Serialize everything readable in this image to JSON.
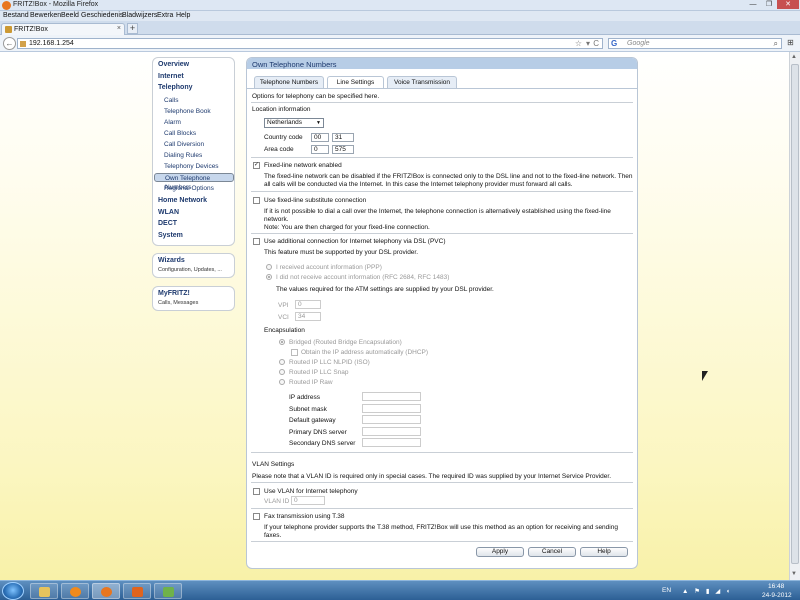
{
  "window": {
    "title": "FRITZ!Box - Mozilla Firefox",
    "min_glyph": "—",
    "max_glyph": "❐",
    "close_glyph": "✕"
  },
  "menubar": [
    "Bestand",
    "Bewerken",
    "Beeld",
    "Geschiedenis",
    "Bladwijzers",
    "Extra",
    "Help"
  ],
  "tab": {
    "label": "FRITZ!Box",
    "close_glyph": "×",
    "new_tab_glyph": "+"
  },
  "navbar": {
    "back_glyph": "←",
    "url": "192.168.1.254",
    "star_glyph": "☆",
    "dropdown_glyph": "▾",
    "reload_glyph": "C",
    "search_engine": "G",
    "search_placeholder": "Google",
    "search_glyph": "⌕",
    "menu_glyph": "⊞"
  },
  "sidebar": {
    "overview": "Overview",
    "internet": "Internet",
    "telephony": "Telephony",
    "sub": [
      "Calls",
      "Telephone Book",
      "Alarm",
      "Call Blocks",
      "Call Diversion",
      "Dialing Rules",
      "Telephony Devices",
      "Own Telephone Numbers",
      "Regional Options"
    ],
    "home_network": "Home Network",
    "wlan": "WLAN",
    "dect": "DECT",
    "system": "System",
    "wizards_title": "Wizards",
    "wizards_sub": "Configuration, Updates, ...",
    "myfritz_title": "MyFRITZ!",
    "myfritz_sub": "Calls, Messages"
  },
  "content": {
    "header": "Own Telephone Numbers",
    "tabs": [
      "Telephone Numbers",
      "Line Settings",
      "Voice Transmission"
    ],
    "intro": "Options for telephony can be specified here.",
    "location_title": "Location information",
    "country_select": "Netherlands",
    "country_code_label": "Country code",
    "country_code_prefix": "00",
    "country_code": "31",
    "area_code_label": "Area code",
    "area_code_prefix": "0",
    "area_code": "575",
    "fixed_line_label": "Fixed-line network enabled",
    "fixed_line_desc1": "The fixed-line network can be disabled if the FRITZ!Box is connected only to the DSL line and not to the fixed-line network. Then",
    "fixed_line_desc2": "all calls will be conducted via the Internet. In this case the Internet telephony provider must forward all calls.",
    "substitute_label": "Use fixed-line substitute connection",
    "substitute_desc1": "If it is not possible to dial a call over the Internet, the telephone connection is alternatively established using the fixed-line",
    "substitute_desc2": "network.",
    "substitute_desc3": "Note: You are then charged for your fixed-line connection.",
    "additional_label": "Use additional connection for Internet telephony via DSL (PVC)",
    "additional_desc": "This feature must be supported by your DSL provider.",
    "radio_received": "I received account information (PPP)",
    "radio_not_received": "I did not receive account information (RFC 2684, RFC 1483)",
    "atm_desc": "The values required for the ATM settings are supplied by your DSL provider.",
    "vpi_label": "VPI",
    "vpi": "0",
    "vci_label": "VCI",
    "vci": "34",
    "encap_title": "Encapsulation",
    "encap_bridged": "Bridged (Routed Bridge Encapsulation)",
    "encap_dhcp": "Obtain the IP address automatically (DHCP)",
    "encap_llc_nlpid": "Routed IP LLC NLPID (ISO)",
    "encap_llc_snap": "Routed IP LLC Snap",
    "encap_raw": "Routed IP Raw",
    "ip_address_label": "IP address",
    "subnet_mask_label": "Subnet mask",
    "default_gateway_label": "Default gateway",
    "primary_dns_label": "Primary DNS server",
    "secondary_dns_label": "Secondary DNS server",
    "vlan_title": "VLAN Settings",
    "vlan_desc": "Please note that a VLAN ID is required only in special cases. The required ID was supplied by your Internet Service Provider.",
    "vlan_use_label": "Use VLAN for Internet telephony",
    "vlan_id_label": "VLAN ID",
    "vlan_id": "0",
    "fax_label": "Fax transmission using T.38",
    "fax_desc1": "If your telephone provider supports the T.38 method, FRITZ!Box will use this method as an option for receiving and sending",
    "fax_desc2": "faxes.",
    "check_glyph": "✓",
    "select_caret": "▼",
    "apply": "Apply",
    "cancel": "Cancel",
    "help": "Help"
  },
  "taskbar": {
    "lang": "EN",
    "time": "16:48",
    "date": "24-9-2012",
    "tray_icons": "▲ ⚑ ▮ ◢ ◖"
  },
  "scroll": {
    "up": "▲",
    "down": "▼"
  },
  "colors": {
    "accent": "#1e3a6e",
    "header": "#b7cde6",
    "selected": "#c7d7ec"
  }
}
